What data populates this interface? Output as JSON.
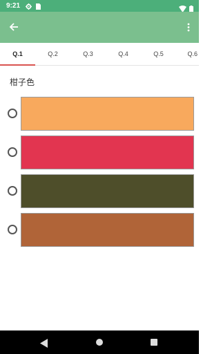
{
  "status_bar": {
    "time": "9:21",
    "icons": [
      "gear-icon",
      "sim-card-icon",
      "wifi-icon",
      "battery-icon"
    ]
  },
  "app_bar": {
    "back_icon": "arrow-left-icon",
    "menu_icon": "more-vertical-icon"
  },
  "tabs": [
    {
      "label": "Q.1",
      "active": true
    },
    {
      "label": "Q.2",
      "active": false
    },
    {
      "label": "Q.3",
      "active": false
    },
    {
      "label": "Q.4",
      "active": false
    },
    {
      "label": "Q.5",
      "active": false
    },
    {
      "label": "Q.6",
      "active": false
    }
  ],
  "question": {
    "title": "柑子色",
    "options": [
      {
        "color": "#f8a95d",
        "selected": false
      },
      {
        "color": "#e23550",
        "selected": false
      },
      {
        "color": "#4e4e2a",
        "selected": false
      },
      {
        "color": "#b06438",
        "selected": false
      }
    ]
  },
  "colors": {
    "status_bar": "#4caf7a",
    "app_bar": "#7bbf8e",
    "tab_indicator": "#d9534f"
  }
}
